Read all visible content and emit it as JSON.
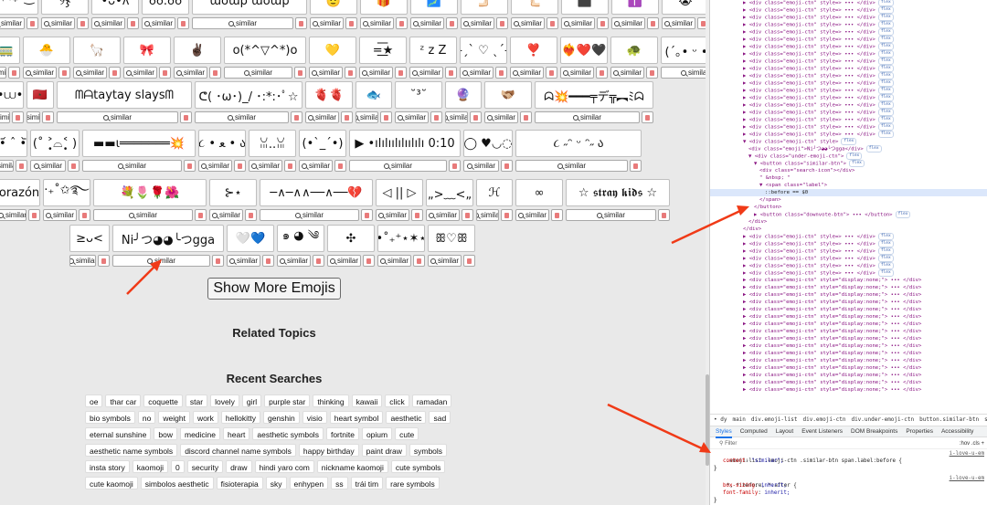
{
  "emoji_rows": [
    [
      {
        "text": "⁺˳✧༚₊˚‿⁀",
        "w": 52
      },
      {
        "text": "୨ჯ",
        "w": 52
      },
      {
        "text": "•ᴗ•ʌ",
        "w": 52
      },
      {
        "text": "ʊʊ.ʊʊ",
        "w": 52
      },
      {
        "text": "ɯoɯƥ ɯoɯƥ",
        "w": 126
      },
      {
        "text": "🫡",
        "w": 52
      },
      {
        "text": "🎁",
        "w": 52
      },
      {
        "text": "🗾",
        "w": 52
      },
      {
        "text": "🫸🏻",
        "w": 52
      },
      {
        "text": "🫷🏻",
        "w": 52
      },
      {
        "text": "⬛",
        "w": 52
      },
      {
        "text": "✝️",
        "w": 52
      },
      {
        "text": "😭",
        "w": 52
      },
      {
        "text": "🫶",
        "w": 52
      }
    ],
    [
      {
        "text": "🚃",
        "w": 30
      },
      {
        "text": "🐣",
        "w": 52
      },
      {
        "text": "🦙",
        "w": 52
      },
      {
        "text": "🎀",
        "w": 52
      },
      {
        "text": "✌🏿",
        "w": 52
      },
      {
        "text": "o(*^▽^*)o",
        "w": 90
      },
      {
        "text": "💛",
        "w": 52
      },
      {
        "text": "=͟͟͞★",
        "w": 52
      },
      {
        "text": "ᶻ z Z",
        "w": 52
      },
      {
        "text": "˗ˏˋ ♡ ˎˊ˗",
        "w": 52
      },
      {
        "text": "❣️",
        "w": 52
      },
      {
        "text": "❤️‍🔥❤️🖤",
        "w": 52
      },
      {
        "text": "🐢",
        "w": 52
      },
      {
        "text": "(´｡• ᵕ •｡`) ♡",
        "w": 90
      }
    ],
    [
      {
        "text": "≽^•⩊•^≼",
        "w": 30
      },
      {
        "text": "🇲🇦",
        "w": 30
      },
      {
        "text": "ᗰᗩtaytay slaysᗰ",
        "w": 148
      },
      {
        "text": "ᕦ( ･ω･)_/ ･:*:･ﾟ☆",
        "w": 118
      },
      {
        "text": "🫀🫀",
        "w": 52
      },
      {
        "text": "🐟",
        "w": 40
      },
      {
        "text": "˘³˘",
        "w": 52
      },
      {
        "text": "🔮",
        "w": 40
      },
      {
        "text": "🫱🏼‍🫲🏾",
        "w": 52
      },
      {
        "text": "ᗣ💥━━━╤デ╦︻ﾐᗣ",
        "w": 130
      }
    ],
    [
      {
        "text": "( •᷄ ˆ •᷅)",
        "w": 36
      },
      {
        "text": "(˚ ˃̣̣̥⌓˂̣̣̥ )",
        "w": 54
      },
      {
        "text": "▬▬ι═══════💥",
        "w": 124
      },
      {
        "text": "૮ • ﻌ • ა",
        "w": 52
      },
      {
        "text": "ꈍ..ꈍ",
        "w": 52
      },
      {
        "text": "(•`_´•)",
        "w": 52
      },
      {
        "text": "▶ •ılılıılılıılılı 0:10",
        "w": 122
      },
      {
        "text": "◯ ♥◡◌",
        "w": 54
      },
      {
        "text": "૮ ˶ᵔ ᵕ ᵔ˶ ა",
        "w": 138
      }
    ],
    [
      {
        "text": "orazón",
        "w": 46
      },
      {
        "text": "⁺‧₊˚✩࿐₊",
        "w": 52
      },
      {
        "text": "💐🌷🌹🌺",
        "w": 124
      },
      {
        "text": "⊱⋆",
        "w": 52
      },
      {
        "text": "─∧─∧∧──∧──💔",
        "w": 124
      },
      {
        "text": "◁ || ▷",
        "w": 52
      },
      {
        "text": "(„>﹏<„)",
        "w": 52
      },
      {
        "text": "ℋ",
        "w": 40
      },
      {
        "text": "∞",
        "w": 52
      },
      {
        "text": "☆ 𝖘𝖙𝖗𝖆𝖞 𝖐𝖎𝖉𝖘 ☆",
        "w": 114
      }
    ],
    [
      {
        "text": "≥ᴗ<",
        "w": 44
      },
      {
        "text": "Ni╯つ◕◕╰つgga",
        "w": 122
      },
      {
        "text": "🤍💙",
        "w": 52
      },
      {
        "text": "๑ ◕ ༄",
        "w": 52
      },
      {
        "text": "✣",
        "w": 52
      },
      {
        "text": "•˚₊⁺⋆✶⋆",
        "w": 52
      },
      {
        "text": "ꕥ♡ꕥ",
        "w": 52
      }
    ]
  ],
  "similar_label": "similar",
  "show_more": "Show More Emojis",
  "related_title": "Related Topics",
  "recent_title": "Recent Searches",
  "recent_searches": [
    "oe",
    "thar car",
    "coquette",
    "star",
    "lovely",
    "girl",
    "purple star",
    "thinking",
    "kawaii",
    "click",
    "ramadan",
    "bio symbols",
    "no",
    "weight",
    "work",
    "hellokitty",
    "genshin",
    "visio",
    "heart symbol",
    "aesthetic",
    "sad",
    "eternal sunshine",
    "bow",
    "medicine",
    "heart",
    "aesthetic symbols",
    "fortnite",
    "opium",
    "cute",
    "aesthetic name symbols",
    "discord channel name symbols",
    "happy birthday",
    "paint draw",
    "symbols",
    "insta story",
    "kaomoji",
    "0",
    "security",
    "draw",
    "hindi yaro com",
    "nickname kaomoji",
    "cute symbols",
    "cute kaomoji",
    "simbolos aesthetic",
    "fisioterapia",
    "sky",
    "enhypen",
    "ss",
    "trái tim",
    "rare symbols"
  ],
  "devtools": {
    "dom_lines": [
      {
        "i": 1,
        "t": "▶ <div class=\"emoji-ctn\" style=> ••• </div>",
        "p": "flex"
      },
      {
        "i": 1,
        "t": "▶ <div class=\"emoji-ctn\" style=> ••• </div>",
        "p": "flex"
      },
      {
        "i": 1,
        "t": "▶ <div class=\"emoji-ctn\" style=> ••• </div>",
        "p": "flex"
      },
      {
        "i": 1,
        "t": "▶ <div class=\"emoji-ctn\" style=> ••• </div>",
        "p": "flex"
      },
      {
        "i": 1,
        "t": "▶ <div class=\"emoji-ctn\" style=> ••• </div>",
        "p": "flex"
      },
      {
        "i": 1,
        "t": "▶ <div class=\"emoji-ctn\" style=> ••• </div>",
        "p": "flex"
      },
      {
        "i": 1,
        "t": "▶ <div class=\"emoji-ctn\" style=> ••• </div>",
        "p": "flex"
      },
      {
        "i": 1,
        "t": "▶ <div class=\"emoji-ctn\" style=> ••• </div>",
        "p": "flex"
      },
      {
        "i": 1,
        "t": "▶ <div class=\"emoji-ctn\" style=> ••• </div>",
        "p": "flex"
      },
      {
        "i": 1,
        "t": "▶ <div class=\"emoji-ctn\" style=> ••• </div>",
        "p": "flex"
      },
      {
        "i": 1,
        "t": "▶ <div class=\"emoji-ctn\" style=> ••• </div>",
        "p": "flex"
      },
      {
        "i": 1,
        "t": "▶ <div class=\"emoji-ctn\" style=> ••• </div>",
        "p": "flex"
      },
      {
        "i": 1,
        "t": "▶ <div class=\"emoji-ctn\" style=> ••• </div>",
        "p": "flex"
      },
      {
        "i": 1,
        "t": "▶ <div class=\"emoji-ctn\" style=> ••• </div>",
        "p": "flex"
      },
      {
        "i": 1,
        "t": "▶ <div class=\"emoji-ctn\" style=> ••• </div>",
        "p": "flex"
      },
      {
        "i": 1,
        "t": "▶ <div class=\"emoji-ctn\" style=> ••• </div>",
        "p": "flex"
      },
      {
        "i": 1,
        "t": "▶ <div class=\"emoji-ctn\" style=> ••• </div>",
        "p": "flex"
      },
      {
        "i": 1,
        "t": "▶ <div class=\"emoji-ctn\" style=> ••• </div>",
        "p": "flex"
      },
      {
        "i": 1,
        "t": "▶ <div class=\"emoji-ctn\" style=> ••• </div>",
        "p": "flex"
      },
      {
        "i": 1,
        "t": "▼ <div class=\"emoji-ctn\" style>",
        "p": "flex"
      },
      {
        "i": 2,
        "t": "<div class=\"emoji\">Ni╯つ◕◕╰つgga</div>",
        "p": "flex"
      },
      {
        "i": 2,
        "t": "▼ <div class=\"under-emoji-ctn\">",
        "p": "flex"
      },
      {
        "i": 3,
        "t": "▼ <button class=\"similar-btn\">",
        "p": "flex"
      },
      {
        "i": 4,
        "t": "<div class=\"search-icon\"></div>",
        "p": ""
      },
      {
        "i": 4,
        "t": "\" &nbsp; \"",
        "p": ""
      },
      {
        "i": 4,
        "t": "▼ <span class=\"label\">",
        "p": ""
      },
      {
        "i": 5,
        "t": "::before == $0",
        "p": "",
        "sel": true
      },
      {
        "i": 4,
        "t": "</span>",
        "p": ""
      },
      {
        "i": 3,
        "t": "</button>",
        "p": ""
      },
      {
        "i": 3,
        "t": "▶ <button class=\"downvote-btn\"> ••• </button>",
        "p": "flex"
      },
      {
        "i": 2,
        "t": "</div>",
        "p": ""
      },
      {
        "i": 1,
        "t": "</div>",
        "p": ""
      },
      {
        "i": 1,
        "t": "▶ <div class=\"emoji-ctn\" style=> ••• </div>",
        "p": "flex"
      },
      {
        "i": 1,
        "t": "▶ <div class=\"emoji-ctn\" style=> ••• </div>",
        "p": "flex"
      },
      {
        "i": 1,
        "t": "▶ <div class=\"emoji-ctn\" style=> ••• </div>",
        "p": "flex"
      },
      {
        "i": 1,
        "t": "▶ <div class=\"emoji-ctn\" style=> ••• </div>",
        "p": "flex"
      },
      {
        "i": 1,
        "t": "▶ <div class=\"emoji-ctn\" style=> ••• </div>",
        "p": "flex"
      },
      {
        "i": 1,
        "t": "▶ <div class=\"emoji-ctn\" style=> ••• </div>",
        "p": "flex"
      },
      {
        "i": 1,
        "t": "▶ <div class=\"emoji-ctn\" style=\"display:none;\"> ••• </div>",
        "p": ""
      },
      {
        "i": 1,
        "t": "▶ <div class=\"emoji-ctn\" style=\"display:none;\"> ••• </div>",
        "p": ""
      },
      {
        "i": 1,
        "t": "▶ <div class=\"emoji-ctn\" style=\"display:none;\"> ••• </div>",
        "p": ""
      },
      {
        "i": 1,
        "t": "▶ <div class=\"emoji-ctn\" style=\"display:none;\"> ••• </div>",
        "p": ""
      },
      {
        "i": 1,
        "t": "▶ <div class=\"emoji-ctn\" style=\"display:none;\"> ••• </div>",
        "p": ""
      },
      {
        "i": 1,
        "t": "▶ <div class=\"emoji-ctn\" style=\"display:none;\"> ••• </div>",
        "p": ""
      },
      {
        "i": 1,
        "t": "▶ <div class=\"emoji-ctn\" style=\"display:none;\"> ••• </div>",
        "p": ""
      },
      {
        "i": 1,
        "t": "▶ <div class=\"emoji-ctn\" style=\"display:none;\"> ••• </div>",
        "p": ""
      },
      {
        "i": 1,
        "t": "▶ <div class=\"emoji-ctn\" style=\"display:none;\"> ••• </div>",
        "p": ""
      },
      {
        "i": 1,
        "t": "▶ <div class=\"emoji-ctn\" style=\"display:none;\"> ••• </div>",
        "p": ""
      },
      {
        "i": 1,
        "t": "▶ <div class=\"emoji-ctn\" style=\"display:none;\"> ••• </div>",
        "p": ""
      },
      {
        "i": 1,
        "t": "▶ <div class=\"emoji-ctn\" style=\"display:none;\"> ••• </div>",
        "p": ""
      },
      {
        "i": 1,
        "t": "▶ <div class=\"emoji-ctn\" style=\"display:none;\"> ••• </div>",
        "p": ""
      },
      {
        "i": 1,
        "t": "▶ <div class=\"emoji-ctn\" style=\"display:none;\"> ••• </div>",
        "p": ""
      },
      {
        "i": 1,
        "t": "▶ <div class=\"emoji-ctn\" style=\"display:none;\"> ••• </div>",
        "p": ""
      },
      {
        "i": 1,
        "t": "▶ <div class=\"emoji-ctn\" style=\"display:none;\"> ••• </div>",
        "p": ""
      }
    ],
    "breadcrumbs": [
      "• dy",
      "main",
      "div.emoji-list",
      "div.emoji-ctn",
      "div.under-emoji-ctn",
      "button.similar-btn",
      "span.label"
    ],
    "panel_tabs": [
      "Styles",
      "Computed",
      "Layout",
      "Event Listeners",
      "DOM Breakpoints",
      "Properties",
      "Accessibility"
    ],
    "active_tab": "Styles",
    "filter_placeholder": "Filter",
    "filter_tools": ":hov .cls +",
    "css_rule1_selector": ".emoji-list .emoji-ctn .similar-btn span.label:before {",
    "css_rule1_prop": "content",
    "css_rule1_val": "\"similar\";",
    "css_rule1_src": "i-love-u-em",
    "css_rule2_selector": "*, *:before, *:after {",
    "css_rule2_prop1": "box-sizing",
    "css_rule2_val1": "inherit;",
    "css_rule2_prop2": "font-family",
    "css_rule2_val2": "inherit;",
    "css_rule2_src": "i-love-u-em",
    "css_close": "}"
  }
}
